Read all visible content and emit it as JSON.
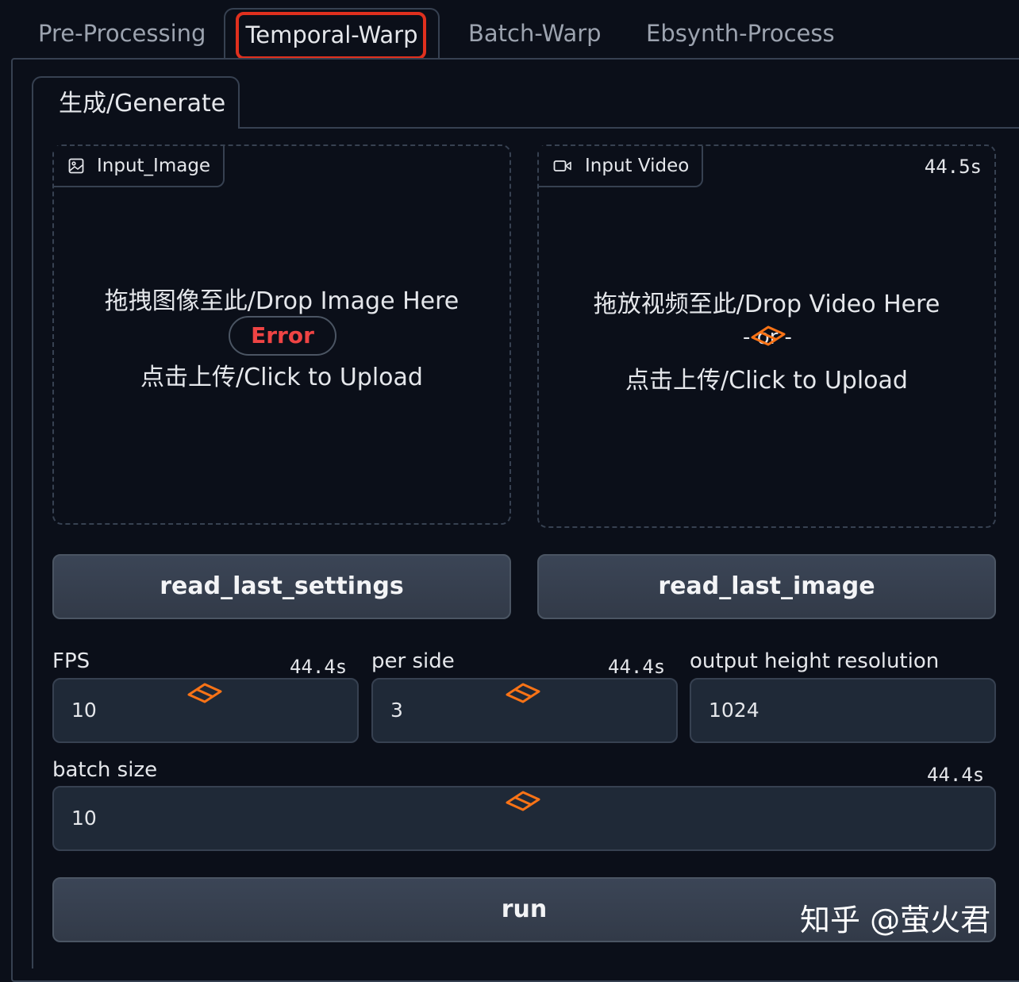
{
  "tabs": [
    {
      "label": "Pre-Processing"
    },
    {
      "label": "Temporal-Warp"
    },
    {
      "label": "Batch-Warp"
    },
    {
      "label": "Ebsynth-Process"
    }
  ],
  "active_tab": "Temporal-Warp",
  "sub_tab": {
    "label": "生成/Generate"
  },
  "image_input": {
    "label": "Input_Image",
    "icon": "image-icon",
    "drop_text": "拖拽图像至此/Drop Image Here",
    "error_text": "Error",
    "click_text": "点击上传/Click to Upload"
  },
  "video_input": {
    "label": "Input Video",
    "icon": "video-icon",
    "timer": "44.5s",
    "drop_text": "拖放视频至此/Drop Video Here",
    "or_text": "- or -",
    "click_text": "点击上传/Click to Upload"
  },
  "buttons": {
    "read_last_settings": "read_last_settings",
    "read_last_image": "read_last_image",
    "run": "run"
  },
  "fields": {
    "fps": {
      "label": "FPS",
      "value": "10",
      "timer": "44.4s"
    },
    "per_side": {
      "label": "per side",
      "value": "3",
      "timer": "44.4s"
    },
    "output_height": {
      "label": "output height resolution",
      "value": "1024"
    },
    "batch_size": {
      "label": "batch size",
      "value": "10",
      "timer": "44.4s"
    }
  },
  "colors": {
    "background": "#0b0f19",
    "highlight_box": "#e0301e",
    "error": "#ef4444",
    "loader": "#f97316"
  },
  "watermark": "知乎 @萤火君"
}
